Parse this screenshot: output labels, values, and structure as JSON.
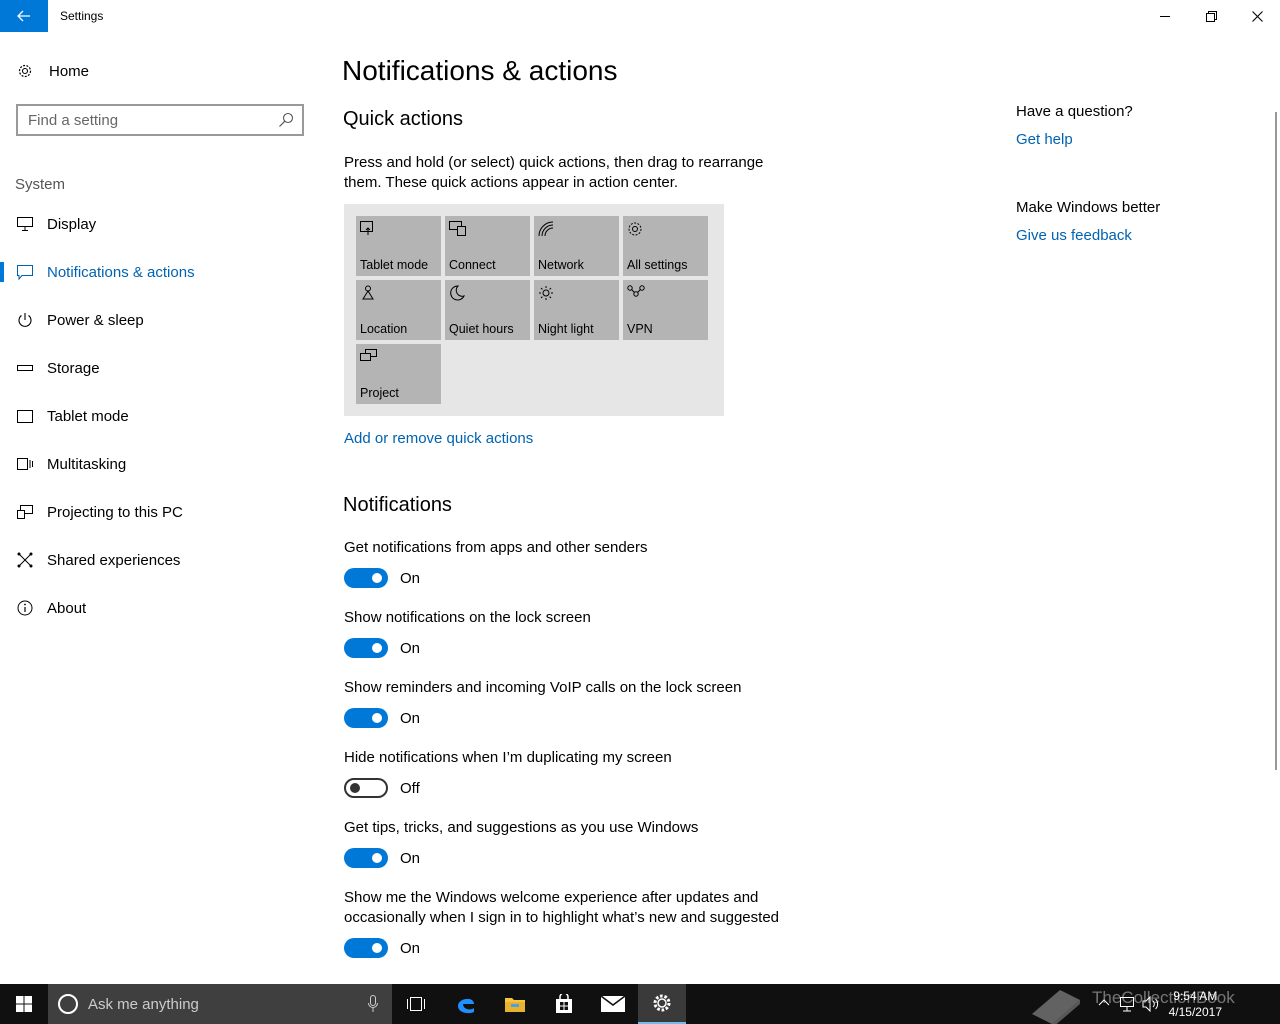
{
  "window": {
    "title": "Settings"
  },
  "sidebar": {
    "home_label": "Home",
    "search_placeholder": "Find a setting",
    "section_label": "System",
    "items": [
      {
        "label": "Display"
      },
      {
        "label": "Notifications & actions"
      },
      {
        "label": "Power & sleep"
      },
      {
        "label": "Storage"
      },
      {
        "label": "Tablet mode"
      },
      {
        "label": "Multitasking"
      },
      {
        "label": "Projecting to this PC"
      },
      {
        "label": "Shared experiences"
      },
      {
        "label": "About"
      }
    ]
  },
  "main": {
    "page_title": "Notifications & actions",
    "quick_actions": {
      "heading": "Quick actions",
      "description": "Press and hold (or select) quick actions, then drag to rearrange them. These quick actions appear in action center.",
      "tiles": [
        {
          "label": "Tablet mode",
          "icon": "tablet-mode-icon"
        },
        {
          "label": "Connect",
          "icon": "connect-icon"
        },
        {
          "label": "Network",
          "icon": "network-icon"
        },
        {
          "label": "All settings",
          "icon": "gear-icon"
        },
        {
          "label": "Location",
          "icon": "location-icon"
        },
        {
          "label": "Quiet hours",
          "icon": "moon-icon"
        },
        {
          "label": "Night light",
          "icon": "sun-icon"
        },
        {
          "label": "VPN",
          "icon": "vpn-icon"
        },
        {
          "label": "Project",
          "icon": "project-icon"
        }
      ],
      "add_remove_link": "Add or remove quick actions"
    },
    "notifications": {
      "heading": "Notifications",
      "settings": [
        {
          "label": "Get notifications from apps and other senders",
          "state": "On"
        },
        {
          "label": "Show notifications on the lock screen",
          "state": "On"
        },
        {
          "label": "Show reminders and incoming VoIP calls on the lock screen",
          "state": "On"
        },
        {
          "label": "Hide notifications when I’m duplicating my screen",
          "state": "Off"
        },
        {
          "label": "Get tips, tricks, and suggestions as you use Windows",
          "state": "On"
        },
        {
          "label": "Show me the Windows welcome experience after updates and occasionally when I sign in to highlight what’s new and suggested",
          "state": "On"
        }
      ]
    }
  },
  "aside": {
    "question": "Have a question?",
    "help_link": "Get help",
    "better": "Make Windows better",
    "feedback_link": "Give us feedback"
  },
  "taskbar": {
    "search_placeholder": "Ask me anything",
    "time": "9:54 AM",
    "date": "4/15/2017",
    "watermark": "TheCollectionBook"
  },
  "colors": {
    "accent": "#0078d7",
    "link": "#0063b1",
    "tile": "#b4b4b4",
    "taskbar": "#101010"
  }
}
